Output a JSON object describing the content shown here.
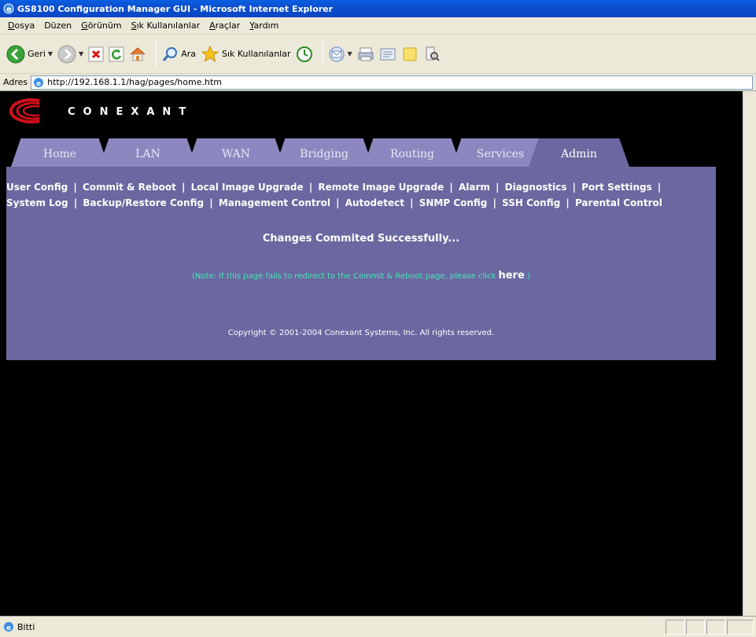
{
  "window": {
    "title": "GS8100 Configuration Manager GUI - Microsoft Internet Explorer"
  },
  "menu": [
    {
      "label": "Dosya",
      "key": "D",
      "rest": "osya"
    },
    {
      "label": "Düzen",
      "key": "",
      "rest": "Düzen"
    },
    {
      "label": "Görünüm",
      "key": "G",
      "rest": "örünüm"
    },
    {
      "label": "Sık Kullanılanlar",
      "key": "S",
      "rest": "ık Kullanılanlar"
    },
    {
      "label": "Araçlar",
      "key": "A",
      "rest": "raçlar"
    },
    {
      "label": "Yardım",
      "key": "Y",
      "rest": "ardım"
    }
  ],
  "toolbar": {
    "back_label": "Geri",
    "search_label": "Ara",
    "favorites_label": "Sık Kullanılanlar"
  },
  "address": {
    "label": "Adres",
    "url": "http://192.168.1.1/hag/pages/home.htm"
  },
  "logo": {
    "text": "CONEXANT"
  },
  "tabs": [
    {
      "label": "Home",
      "active": false
    },
    {
      "label": "LAN",
      "active": false
    },
    {
      "label": "WAN",
      "active": false
    },
    {
      "label": "Bridging",
      "active": false
    },
    {
      "label": "Routing",
      "active": false
    },
    {
      "label": "Services",
      "active": false
    },
    {
      "label": "Admin",
      "active": true
    }
  ],
  "admin_links": {
    "row1": [
      "User Config",
      "Commit & Reboot",
      "Local Image Upgrade",
      "Remote Image Upgrade",
      "Alarm",
      "Diagnostics",
      "Port Settings"
    ],
    "row2": [
      "System Log",
      "Backup/Restore Config",
      "Management Control",
      "Autodetect",
      "SNMP Config",
      "SSH Config",
      "Parental Control"
    ]
  },
  "messages": {
    "success": "Changes Commited Successfully...",
    "note_prefix": "(Note: If this page fails to redirect to the Commit & Reboot page, please click ",
    "note_link": "here",
    "note_suffix": ".)",
    "copyright": "Copyright © 2001-2004 Conexant Systems, Inc. All rights reserved."
  },
  "status": {
    "text": "Bitti"
  },
  "colors": {
    "tab_inactive": "#8c88bf",
    "tab_active": "#6b67a0",
    "panel": "#6b67a0",
    "note_text": "#43e8b4",
    "background": "#000000"
  }
}
